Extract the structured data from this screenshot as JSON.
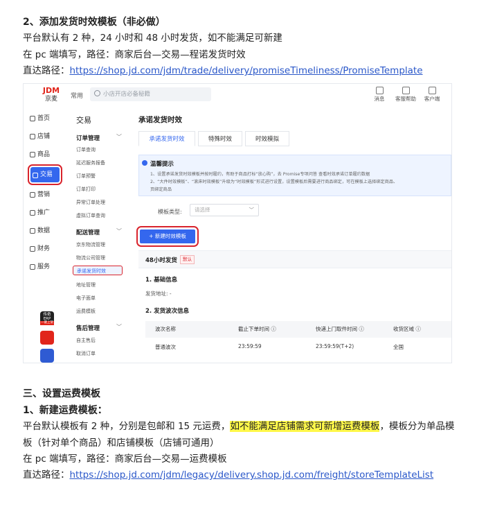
{
  "doc": {
    "h2": "2、添加发货时效模板（非必做）",
    "p1": "平台默认有 2 种，24 小时和 48 小时发货，如不能满足可新建",
    "p2": "在 pc 端填写，路径：商家后台—交易—程诺发货时效",
    "p3_label": "直达路径：",
    "p3_link": "https://shop.jd.com/jdm/trade/delivery/promiseTimeliness/PromiseTemplate",
    "h3": "三、设置运费模板",
    "h3_1": "1、新建运费模板：",
    "p4_a": "平台默认模板有 2 种，分别是包邮和 15 元运费，",
    "p4_hl": "如不能满足店铺需求可新增运费模板",
    "p4_b": "，模板分为单品模",
    "p4_c": "板（针对单个商品）和店铺模板（店铺可通用）",
    "p5": "在 pc 端填写，路径：商家后台—交易—运费模板",
    "p6_label": "直达路径：",
    "p6_link": "https://shop.jd.com/jdm/legacy/delivery.shop.jd.com/freight/storeTemplateList"
  },
  "shot": {
    "logo_top": "JDM",
    "logo_bottom": "京麦",
    "common": "常用",
    "search_placeholder": "小店开店必备秘籍",
    "top_icons": [
      "消息",
      "客服帮助",
      "客户端"
    ],
    "nav": [
      "首页",
      "店铺",
      "商品",
      "交易",
      "营销",
      "推广",
      "数据",
      "财务",
      "服务"
    ],
    "sub_title": "交易",
    "sub_groups": [
      "订单管理",
      "配送管理",
      "售后管理"
    ],
    "sub_items_order": [
      "订单查询",
      "延迟服务报备",
      "订单预警",
      "订单打印",
      "异常订单处理",
      "虚拟订单查询"
    ],
    "sub_items_delivery": [
      "京东物流管理",
      "物流公司管理",
      "承诺发货时效",
      "地址管理",
      "电子面单",
      "运费模板"
    ],
    "sub_items_after": [
      "自主售后",
      "取消订单"
    ],
    "page_title": "承诺发货时效",
    "tabs": [
      "承诺发货时效",
      "特殊时效",
      "时效模拟"
    ],
    "tip_title": "温馨提示",
    "tip_lines": [
      "1、设置承诺发货时效模板并按时履约，有助于商品打标“放心购”，去 Promise专项问答 查看时效承诺订单履约数据",
      "2、“大件时效模板”、“滚床时效模板”升级为“时效模板”形式进行设置，设置模板后需要进行商品绑定，可在模板上选择绑定商品、",
      "页绑定商品"
    ],
    "filter_label": "模板类型:",
    "filter_placeholder": "请选择",
    "new_button": "+ 新建时效模板",
    "section_title": "48小时发货",
    "section_badge": "默认",
    "basic_info": "1. 基础信息",
    "ship_addr": "发货地址: -",
    "batch_info": "2. 发货波次信息",
    "table_headers": [
      "波次名称",
      "截止下单时间 ⓘ",
      "快递上门取件时间 ⓘ",
      "收货区域 ⓘ"
    ],
    "table_row": [
      "普通波次",
      "23:59:59",
      "23:59:59(T+2)",
      "全国"
    ],
    "app_badge_top": "传奇",
    "app_badge_mid": "ERP",
    "app_badge_tag": "一键上架"
  }
}
